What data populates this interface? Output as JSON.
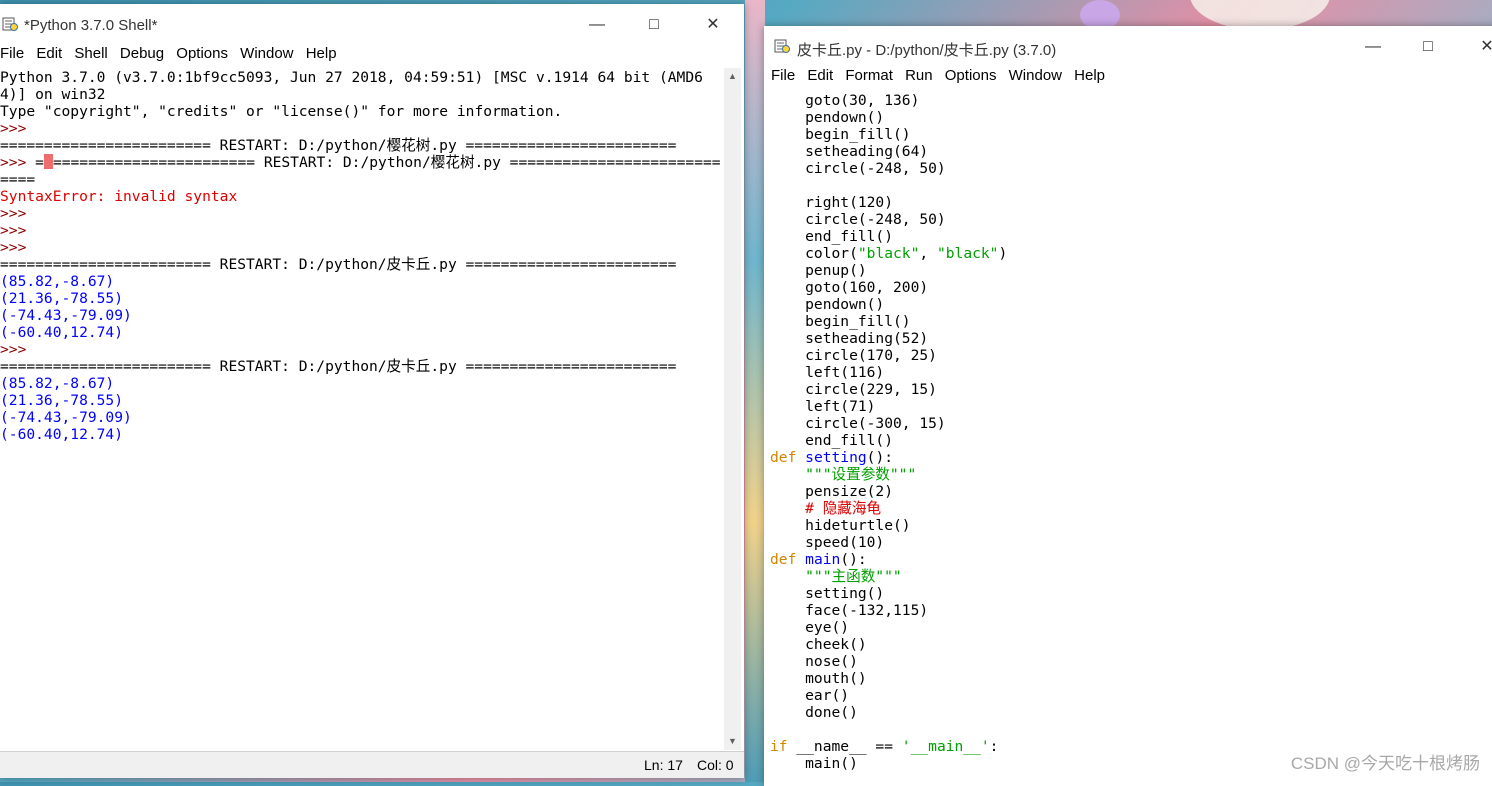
{
  "shell": {
    "title": "*Python 3.7.0 Shell*",
    "menu": [
      "File",
      "Edit",
      "Shell",
      "Debug",
      "Options",
      "Window",
      "Help"
    ],
    "lines": [
      [
        {
          "t": "Python 3.7.0 (v3.7.0:1bf9cc5093, Jun 27 2018, 04:59:51) [MSC v.1914 64 bit (AMD6",
          "c": ""
        }
      ],
      [
        {
          "t": "4)] on win32",
          "c": ""
        }
      ],
      [
        {
          "t": "Type \"copyright\", \"credits\" or \"license()\" for more information.",
          "c": ""
        }
      ],
      [
        {
          "t": ">>> ",
          "c": "prm"
        }
      ],
      [
        {
          "t": "======================== RESTART: D:/python/樱花树.py ========================",
          "c": ""
        }
      ],
      [
        {
          "t": ">>> ",
          "c": "prm"
        },
        {
          "t": "=",
          "c": ""
        },
        {
          "t": "",
          "c": "cursor"
        },
        {
          "t": "======================= RESTART: D:/python/樱花树.py ========================",
          "c": ""
        }
      ],
      [
        {
          "t": "====",
          "c": ""
        }
      ],
      [
        {
          "t": "SyntaxError: invalid syntax",
          "c": "err"
        }
      ],
      [
        {
          "t": ">>> ",
          "c": "prm"
        }
      ],
      [
        {
          "t": ">>> ",
          "c": "prm"
        }
      ],
      [
        {
          "t": ">>> ",
          "c": "prm"
        }
      ],
      [
        {
          "t": "======================== RESTART: D:/python/皮卡丘.py ========================",
          "c": ""
        }
      ],
      [
        {
          "t": "(85.82,-8.67)",
          "c": "out"
        }
      ],
      [
        {
          "t": "(21.36,-78.55)",
          "c": "out"
        }
      ],
      [
        {
          "t": "(-74.43,-79.09)",
          "c": "out"
        }
      ],
      [
        {
          "t": "(-60.40,12.74)",
          "c": "out"
        }
      ],
      [
        {
          "t": ">>> ",
          "c": "prm"
        }
      ],
      [
        {
          "t": "======================== RESTART: D:/python/皮卡丘.py ========================",
          "c": ""
        }
      ],
      [
        {
          "t": "(85.82,-8.67)",
          "c": "out"
        }
      ],
      [
        {
          "t": "(21.36,-78.55)",
          "c": "out"
        }
      ],
      [
        {
          "t": "(-74.43,-79.09)",
          "c": "out"
        }
      ],
      [
        {
          "t": "(-60.40,12.74)",
          "c": "out"
        }
      ]
    ],
    "status_ln": "Ln: 17",
    "status_col": "Col: 0"
  },
  "editor": {
    "title": "皮卡丘.py - D:/python/皮卡丘.py (3.7.0)",
    "menu": [
      "File",
      "Edit",
      "Format",
      "Run",
      "Options",
      "Window",
      "Help"
    ],
    "lines": [
      [
        {
          "t": "    goto(30, 136)",
          "c": ""
        }
      ],
      [
        {
          "t": "    pendown()",
          "c": ""
        }
      ],
      [
        {
          "t": "    begin_fill()",
          "c": ""
        }
      ],
      [
        {
          "t": "    setheading(64)",
          "c": ""
        }
      ],
      [
        {
          "t": "    circle(-248, 50)",
          "c": ""
        }
      ],
      [
        {
          "t": "",
          "c": ""
        }
      ],
      [
        {
          "t": "    right(120)",
          "c": ""
        }
      ],
      [
        {
          "t": "    circle(-248, 50)",
          "c": ""
        }
      ],
      [
        {
          "t": "    end_fill()",
          "c": ""
        }
      ],
      [
        {
          "t": "    color(",
          "c": ""
        },
        {
          "t": "\"black\"",
          "c": "str"
        },
        {
          "t": ", ",
          "c": ""
        },
        {
          "t": "\"black\"",
          "c": "str"
        },
        {
          "t": ")",
          "c": ""
        }
      ],
      [
        {
          "t": "    penup()",
          "c": ""
        }
      ],
      [
        {
          "t": "    goto(160, 200)",
          "c": ""
        }
      ],
      [
        {
          "t": "    pendown()",
          "c": ""
        }
      ],
      [
        {
          "t": "    begin_fill()",
          "c": ""
        }
      ],
      [
        {
          "t": "    setheading(52)",
          "c": ""
        }
      ],
      [
        {
          "t": "    circle(170, 25)",
          "c": ""
        }
      ],
      [
        {
          "t": "    left(116)",
          "c": ""
        }
      ],
      [
        {
          "t": "    circle(229, 15)",
          "c": ""
        }
      ],
      [
        {
          "t": "    left(71)",
          "c": ""
        }
      ],
      [
        {
          "t": "    circle(-300, 15)",
          "c": ""
        }
      ],
      [
        {
          "t": "    end_fill()",
          "c": ""
        }
      ],
      [
        {
          "t": "def ",
          "c": "kw"
        },
        {
          "t": "setting",
          "c": "def"
        },
        {
          "t": "():",
          "c": ""
        }
      ],
      [
        {
          "t": "    \"\"\"设置参数\"\"\"",
          "c": "str"
        }
      ],
      [
        {
          "t": "    pensize(2)",
          "c": ""
        }
      ],
      [
        {
          "t": "    # 隐藏海龟",
          "c": "cmt"
        }
      ],
      [
        {
          "t": "    hideturtle()",
          "c": ""
        }
      ],
      [
        {
          "t": "    speed(10)",
          "c": ""
        }
      ],
      [
        {
          "t": "def ",
          "c": "kw"
        },
        {
          "t": "main",
          "c": "def"
        },
        {
          "t": "():",
          "c": ""
        }
      ],
      [
        {
          "t": "    \"\"\"主函数\"\"\"",
          "c": "str"
        }
      ],
      [
        {
          "t": "    setting()",
          "c": ""
        }
      ],
      [
        {
          "t": "    face(-132,115)",
          "c": ""
        }
      ],
      [
        {
          "t": "    eye()",
          "c": ""
        }
      ],
      [
        {
          "t": "    cheek()",
          "c": ""
        }
      ],
      [
        {
          "t": "    nose()",
          "c": ""
        }
      ],
      [
        {
          "t": "    mouth()",
          "c": ""
        }
      ],
      [
        {
          "t": "    ear()",
          "c": ""
        }
      ],
      [
        {
          "t": "    done()",
          "c": ""
        }
      ],
      [
        {
          "t": "",
          "c": ""
        }
      ],
      [
        {
          "t": "if ",
          "c": "kw"
        },
        {
          "t": "__name__ == ",
          "c": ""
        },
        {
          "t": "'__main__'",
          "c": "str"
        },
        {
          "t": ":",
          "c": ""
        }
      ],
      [
        {
          "t": "    main()",
          "c": ""
        }
      ]
    ]
  },
  "watermark": "CSDN @今天吃十根烤肠"
}
